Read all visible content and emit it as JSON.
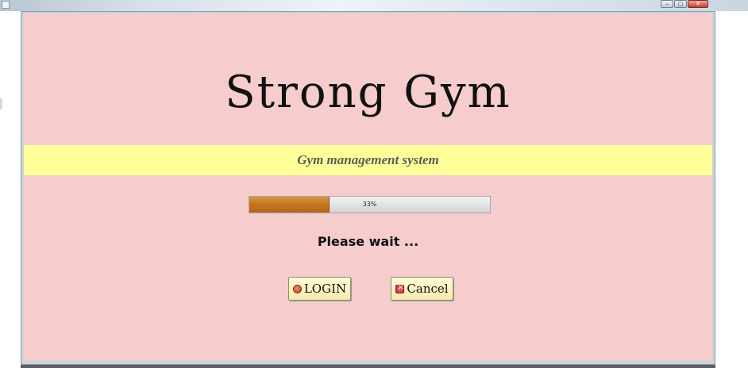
{
  "window": {
    "title": "",
    "buttons": [
      "minimize",
      "maximize",
      "close"
    ]
  },
  "app": {
    "heading": "Strong Gym",
    "subtitle": "Gym management system"
  },
  "progress": {
    "value": 0.33,
    "label": "33%",
    "fill_color": "#c5761f"
  },
  "status": {
    "text": "Please wait ..."
  },
  "buttons": {
    "login_label": "LOGIN",
    "cancel_label": "Cancel"
  },
  "icons": {
    "app": "java-cup-icon",
    "login": "login-icon",
    "cancel": "cancel-icon"
  },
  "colors": {
    "background": "#f6cccc",
    "band": "#ffff99",
    "button": "#fffbd6"
  }
}
